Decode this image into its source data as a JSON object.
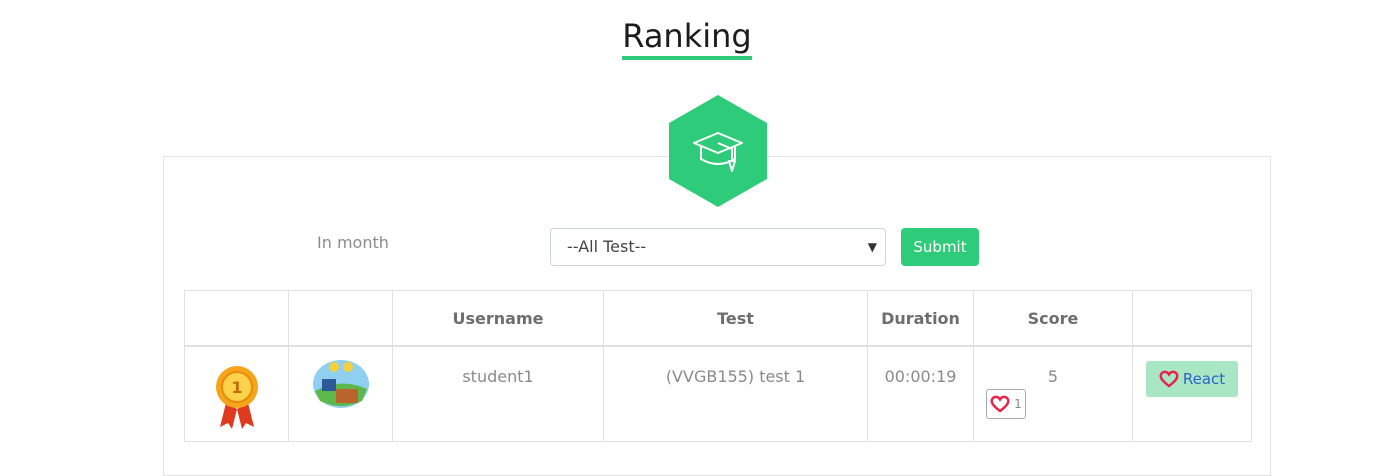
{
  "header": {
    "title": "Ranking"
  },
  "filters": {
    "label": "In month",
    "test_select": {
      "selected": "--All Test--"
    },
    "submit_label": "Submit"
  },
  "table": {
    "headers": [
      "",
      "",
      "Username",
      "Test",
      "Duration",
      "Score",
      ""
    ],
    "rows": [
      {
        "rank_icon": "gold-medal-icon",
        "avatar": "user-avatar",
        "username": "student1",
        "test": "(VVGB155) test 1",
        "duration": "00:00:19",
        "score": "5",
        "reactions": "1",
        "react_label": "React"
      }
    ]
  },
  "colors": {
    "accent": "#2ecc7a",
    "react_bg": "#a8e6c4",
    "react_text": "#2c62c9",
    "heart": "#e8234a"
  }
}
